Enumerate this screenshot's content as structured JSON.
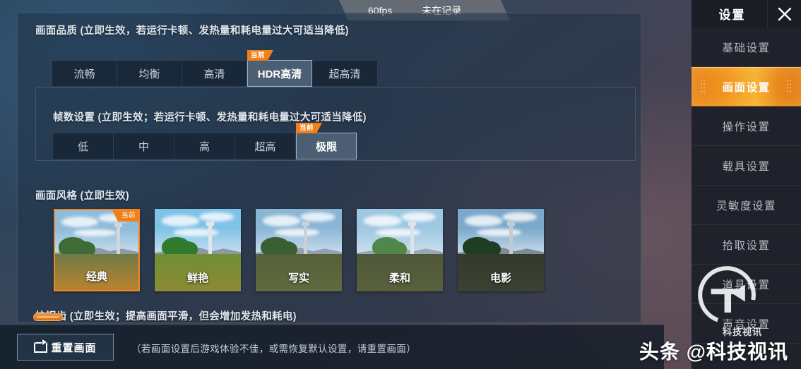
{
  "status_bar": {
    "fps": "60fps",
    "recording": "未在记录"
  },
  "quality": {
    "title": "画面品质 (立即生效，若运行卡顿、发热量和耗电量过大可适当降低)",
    "current_badge": "当前",
    "selected": "HDR高清",
    "options": [
      "流畅",
      "均衡",
      "高清",
      "HDR高清",
      "超高清"
    ]
  },
  "framerate": {
    "title": "帧数设置 (立即生效；若运行卡顿、发热量和耗电量过大可适当降低)",
    "current_badge": "当前",
    "selected": "极限",
    "options": [
      "低",
      "中",
      "高",
      "超高",
      "极限"
    ]
  },
  "style": {
    "title": "画面风格 (立即生效)",
    "current_badge": "当前",
    "selected": "经典",
    "options": [
      {
        "label": "经典",
        "sky": "#8fbcdb",
        "mountain": "#8e9aa6",
        "ground": "#b9832f",
        "field": "#6f7a46",
        "tree": "#3e6b36",
        "tower": "#cfd6dc"
      },
      {
        "label": "鲜艳",
        "sky": "#7fc2e8",
        "mountain": "#8d98a4",
        "ground": "#8d8a36",
        "field": "#6f8f34",
        "tree": "#2f7a2c",
        "tower": "#e0e6ea"
      },
      {
        "label": "写实",
        "sky": "#8ab6d6",
        "mountain": "#94a0ac",
        "ground": "#5f6b3f",
        "field": "#55603a",
        "tree": "#3a5f33",
        "tower": "#c9d1d8"
      },
      {
        "label": "柔和",
        "sky": "#9ec8e2",
        "mountain": "#9aa6b2",
        "ground": "#58603c",
        "field": "#4e5838",
        "tree": "#52874a",
        "tower": "#dde3e8"
      },
      {
        "label": "电影",
        "sky": "#7ba8cb",
        "mountain": "#7e8a97",
        "ground": "#3b4232",
        "field": "#333a2c",
        "tree": "#1f3d22",
        "tower": "#c2cad2"
      }
    ]
  },
  "antialias": {
    "title": "抗锯齿 (立即生效；提高画面平滑，但会增加发热和耗电)"
  },
  "bottom": {
    "reset_label": "重置画面",
    "hint": "（若画面设置后游戏体验不佳，或需恢复默认设置，请重置画面）"
  },
  "sidebar": {
    "title": "设置",
    "close_icon": "close-icon",
    "items": [
      {
        "label": "基础设置",
        "active": false
      },
      {
        "label": "画面设置",
        "active": true
      },
      {
        "label": "操作设置",
        "active": false
      },
      {
        "label": "载具设置",
        "active": false
      },
      {
        "label": "灵敏度设置",
        "active": false
      },
      {
        "label": "拾取设置",
        "active": false
      },
      {
        "label": "道具设置",
        "active": false
      },
      {
        "label": "声音设置",
        "active": false
      }
    ]
  },
  "watermark": {
    "small": "科技视讯",
    "big": "头条 @科技视讯"
  },
  "colors": {
    "accent": "#ef8018",
    "panel_bg": "#1f3246",
    "sidebar_bg": "#20222b",
    "text": "#dfe7ee"
  }
}
